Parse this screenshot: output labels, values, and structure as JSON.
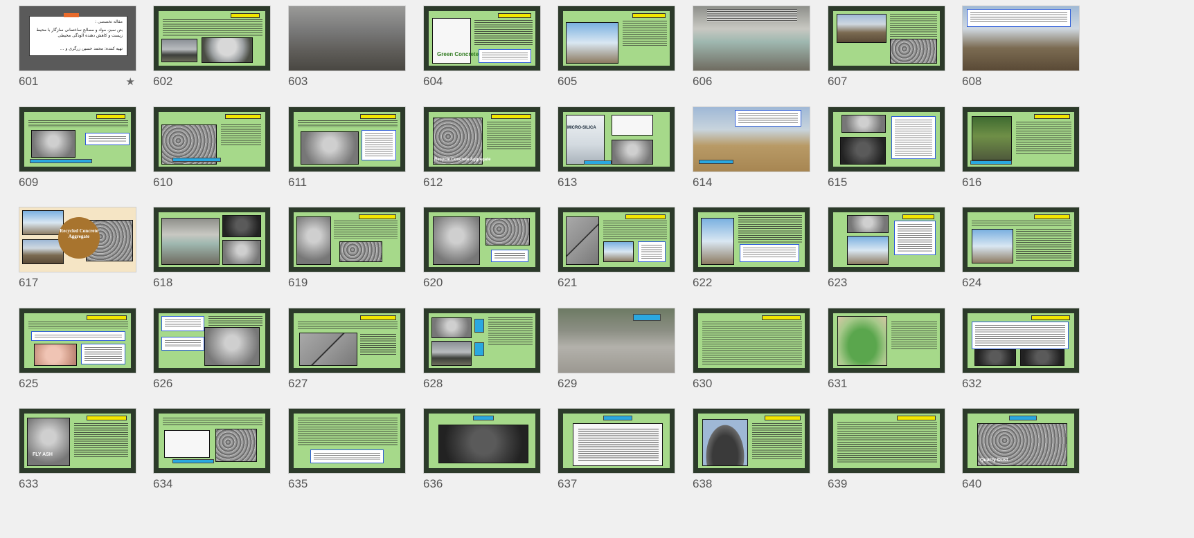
{
  "slide_sorter": {
    "slides": [
      {
        "number": "601",
        "starred": true,
        "kind": "title",
        "title_text": "مقاله تخصصی :",
        "subtitle_text": "بتن سبز، مواد و مصالح ساختمانی سازگار با محیط زیست و کاهش دهنده آلودگی محیطی",
        "author_text": "تهیه کننده: محمد حسین زرگری و ...",
        "star_glyph": "★"
      },
      {
        "number": "602",
        "starred": false,
        "kind": "green"
      },
      {
        "number": "603",
        "starred": false,
        "kind": "photo"
      },
      {
        "number": "604",
        "starred": false,
        "kind": "green",
        "image_text": "Green Concrete"
      },
      {
        "number": "605",
        "starred": false,
        "kind": "green"
      },
      {
        "number": "606",
        "starred": false,
        "kind": "photo"
      },
      {
        "number": "607",
        "starred": false,
        "kind": "green"
      },
      {
        "number": "608",
        "starred": false,
        "kind": "photo"
      },
      {
        "number": "609",
        "starred": false,
        "kind": "green"
      },
      {
        "number": "610",
        "starred": false,
        "kind": "green"
      },
      {
        "number": "611",
        "starred": false,
        "kind": "green"
      },
      {
        "number": "612",
        "starred": false,
        "kind": "green",
        "image_text": "Recycle Concrete Aggregate"
      },
      {
        "number": "613",
        "starred": false,
        "kind": "green",
        "image_text": "MICRO-SILICA"
      },
      {
        "number": "614",
        "starred": false,
        "kind": "photo"
      },
      {
        "number": "615",
        "starred": false,
        "kind": "green"
      },
      {
        "number": "616",
        "starred": false,
        "kind": "green"
      },
      {
        "number": "617",
        "starred": false,
        "kind": "photo",
        "image_text": "Recycled Concrete Aggregate"
      },
      {
        "number": "618",
        "starred": false,
        "kind": "green"
      },
      {
        "number": "619",
        "starred": false,
        "kind": "green"
      },
      {
        "number": "620",
        "starred": false,
        "kind": "green"
      },
      {
        "number": "621",
        "starred": false,
        "kind": "green"
      },
      {
        "number": "622",
        "starred": false,
        "kind": "green"
      },
      {
        "number": "623",
        "starred": false,
        "kind": "green"
      },
      {
        "number": "624",
        "starred": false,
        "kind": "green"
      },
      {
        "number": "625",
        "starred": false,
        "kind": "green"
      },
      {
        "number": "626",
        "starred": false,
        "kind": "green"
      },
      {
        "number": "627",
        "starred": false,
        "kind": "green"
      },
      {
        "number": "628",
        "starred": false,
        "kind": "green"
      },
      {
        "number": "629",
        "starred": false,
        "kind": "photo"
      },
      {
        "number": "630",
        "starred": false,
        "kind": "green"
      },
      {
        "number": "631",
        "starred": false,
        "kind": "green"
      },
      {
        "number": "632",
        "starred": false,
        "kind": "green"
      },
      {
        "number": "633",
        "starred": false,
        "kind": "green",
        "image_text": "FLY ASH"
      },
      {
        "number": "634",
        "starred": false,
        "kind": "green"
      },
      {
        "number": "635",
        "starred": false,
        "kind": "green"
      },
      {
        "number": "636",
        "starred": false,
        "kind": "green"
      },
      {
        "number": "637",
        "starred": false,
        "kind": "green"
      },
      {
        "number": "638",
        "starred": false,
        "kind": "green"
      },
      {
        "number": "639",
        "starred": false,
        "kind": "green"
      },
      {
        "number": "640",
        "starred": false,
        "kind": "green",
        "image_text": "Quarry Dust"
      }
    ]
  },
  "colors": {
    "app_background": "#f0f0f0",
    "slide_frame": "#2c3a2a",
    "slide_green": "#a6d98a",
    "title_yellow": "#f2e600",
    "caption_blue": "#2aa8e0",
    "slide_number_text": "#555555"
  }
}
